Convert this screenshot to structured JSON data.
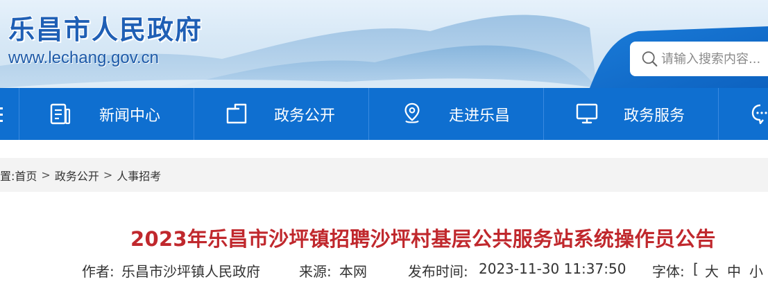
{
  "header": {
    "site_title": "乐昌市人民政府",
    "site_url": "www.lechang.gov.cn",
    "search_placeholder": "请输入搜索内容..."
  },
  "nav": {
    "items": [
      {
        "label": "新闻中心",
        "icon": "news-icon"
      },
      {
        "label": "政务公开",
        "icon": "folder-icon"
      },
      {
        "label": "走进乐昌",
        "icon": "location-pin-icon"
      },
      {
        "label": "政务服务",
        "icon": "monitor-icon"
      }
    ]
  },
  "breadcrumb": {
    "prefix": "置:",
    "items": [
      "首页",
      "政务公开",
      "人事招考"
    ],
    "separator": ">"
  },
  "article": {
    "title": "2023年乐昌市沙坪镇招聘沙坪村基层公共服务站系统操作员公告",
    "author_label": "作者:",
    "author": "乐昌市沙坪镇人民政府",
    "source_label": "来源:",
    "source": "本网",
    "time_label": "发布时间:",
    "time": "2023-11-30 11:37:50",
    "font_label": "字体:",
    "font_open": "[",
    "font_sizes": [
      "大",
      "中",
      "小"
    ]
  },
  "colors": {
    "nav_bg": "#0f6fd0",
    "title_red": "#c0282d",
    "brand_blue": "#1f5fb5"
  }
}
